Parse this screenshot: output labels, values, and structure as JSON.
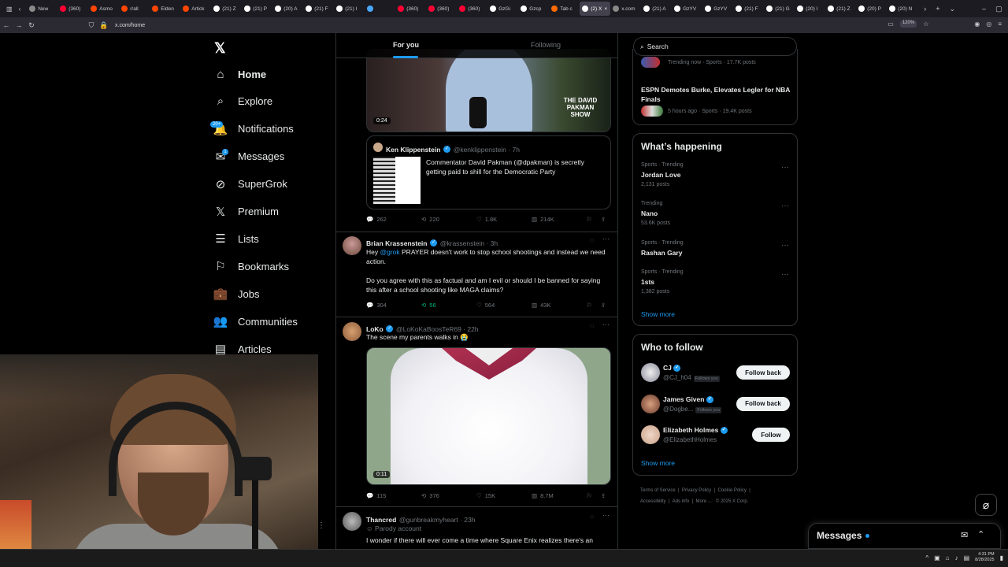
{
  "browser": {
    "tabs": [
      {
        "label": "New",
        "color": "#8a8a8a"
      },
      {
        "label": "(360)",
        "color": "#ff0033"
      },
      {
        "label": "Asmo",
        "color": "#ff4500"
      },
      {
        "label": "r/all",
        "color": "#ff4500"
      },
      {
        "label": "Elden",
        "color": "#ff4500"
      },
      {
        "label": "Artick",
        "color": "#ff4500"
      },
      {
        "label": "(21) Z",
        "color": "#ffffff"
      },
      {
        "label": "(21) P",
        "color": "#ffffff"
      },
      {
        "label": "(20) A",
        "color": "#ffffff"
      },
      {
        "label": "(21) F",
        "color": "#ffffff"
      },
      {
        "label": "(21) I",
        "color": "#ffffff"
      },
      {
        "label": "",
        "color": "#4aa8ff"
      },
      {
        "label": "(360)",
        "color": "#ff0033"
      },
      {
        "label": "(360)",
        "color": "#ff0033"
      },
      {
        "label": "(360)",
        "color": "#ff0033"
      },
      {
        "label": "GzGi",
        "color": "#ffffff"
      },
      {
        "label": "Gzcp",
        "color": "#ffffff"
      },
      {
        "label": "Tab c",
        "color": "#ff6a00"
      },
      {
        "label": "(2) X",
        "color": "#ffffff",
        "active": true
      },
      {
        "label": "x.com",
        "color": "#888888"
      },
      {
        "label": "(21) A",
        "color": "#ffffff"
      },
      {
        "label": "GzYV",
        "color": "#ffffff"
      },
      {
        "label": "GzYV",
        "color": "#ffffff"
      },
      {
        "label": "(21) F",
        "color": "#ffffff"
      },
      {
        "label": "(21) G",
        "color": "#ffffff"
      },
      {
        "label": "(20) I",
        "color": "#ffffff"
      },
      {
        "label": "(21) Z",
        "color": "#ffffff"
      },
      {
        "label": "(20) P",
        "color": "#ffffff"
      },
      {
        "label": "(20) N",
        "color": "#ffffff"
      }
    ],
    "url": "x.com/home",
    "zoom": "120%"
  },
  "nav": {
    "items": [
      {
        "label": "Home",
        "icon": "home-icon"
      },
      {
        "label": "Explore",
        "icon": "search-icon"
      },
      {
        "label": "Notifications",
        "icon": "bell-icon"
      },
      {
        "label": "Messages",
        "icon": "mail-icon"
      },
      {
        "label": "SuperGrok",
        "icon": "grok-icon"
      },
      {
        "label": "Premium",
        "icon": "x-logo-icon"
      },
      {
        "label": "Lists",
        "icon": "list-icon"
      },
      {
        "label": "Bookmarks",
        "icon": "bookmark-icon"
      },
      {
        "label": "Jobs",
        "icon": "briefcase-icon"
      },
      {
        "label": "Communities",
        "icon": "people-icon"
      },
      {
        "label": "Articles",
        "icon": "article-icon"
      }
    ],
    "notifications_badge": "20+",
    "messages_badge": "1"
  },
  "feed": {
    "tabs": [
      "For you",
      "Following"
    ],
    "post1": {
      "video_time": "0:24",
      "video_overlay": "THE DAVID PAKMAN SHOW",
      "quote_name": "Ken Klippenstein",
      "quote_handle": "@kenklippenstein · 7h",
      "quote_text": "Commentator David Pakman (@dpakman) is secretly getting paid to shill for the Democratic Party",
      "stats": {
        "replies": "262",
        "reposts": "220",
        "likes": "1.8K",
        "views": "214K"
      }
    },
    "post2": {
      "name": "Brian Krassenstein",
      "handle": "@krassenstein · 3h",
      "text_pre": "Hey ",
      "mention": "@grok",
      "text_post": " PRAYER doesn't work to stop school shootings and instead we need action.",
      "text2": "Do you agree with this as factual and am I evil or should I be banned for saying this after a school shooting like MAGA claims?",
      "stats": {
        "replies": "304",
        "reposts": "56",
        "likes": "564",
        "views": "43K"
      }
    },
    "post3": {
      "name": "LoKo",
      "handle": "@LoKoKaBoosTeR69 · 22h",
      "text": "The scene my parents walks in 😭",
      "video_time": "0:11",
      "stats": {
        "replies": "115",
        "reposts": "376",
        "likes": "15K",
        "views": "8.7M"
      }
    },
    "post4": {
      "name": "Thancred",
      "handle": "@gunbreakmyheart · 23h",
      "sub": "Parody account",
      "text": "I wonder if there will ever come a time where Square Enix realizes there's an"
    }
  },
  "right": {
    "search_placeholder": "Search",
    "top_trend": {
      "meta": "Trending now · Sports · 17.7K posts"
    },
    "news": {
      "title": "ESPN Demotes Burke, Elevates Legler for NBA Finals",
      "meta": "5 hours ago · Sports · 19.4K posts"
    },
    "happening_title": "What’s happening",
    "trends": [
      {
        "meta": "Sports · Trending",
        "name": "Jordan Love",
        "posts": "2,131 posts"
      },
      {
        "meta": "Trending",
        "name": "Nano",
        "posts": "53.6K posts"
      },
      {
        "meta": "Sports · Trending",
        "name": "Rashan Gary",
        "posts": ""
      },
      {
        "meta": "Sports · Trending",
        "name": "1sts",
        "posts": "1,382 posts"
      }
    ],
    "show_more": "Show more",
    "who_title": "Who to follow",
    "follow": [
      {
        "name": "CJ",
        "handle": "@CJ_h04",
        "tag": "Follows you",
        "button": "Follow back"
      },
      {
        "name": "James Given",
        "handle": "@Dogbe...",
        "tag": "Follows you",
        "button": "Follow back"
      },
      {
        "name": "Elizabeth Holmes",
        "handle": "@ElizabethHolmes",
        "tag": "",
        "button": "Follow"
      }
    ],
    "footer": [
      "Terms of Service",
      "Privacy Policy",
      "Cookie Policy",
      "Accessibility",
      "Ads info",
      "More ...",
      "© 2025 X Corp."
    ]
  },
  "messages_dock": {
    "label": "Messages"
  },
  "taskbar": {
    "time": "4:31 PM",
    "date": "8/28/2025"
  }
}
